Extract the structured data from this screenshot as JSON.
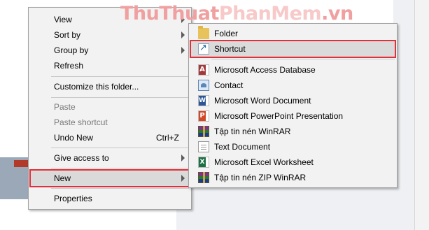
{
  "watermark": {
    "part1": "ThuThuat",
    "part2": "PhanMem",
    "part3": ".vn"
  },
  "context_menu": {
    "view": "View",
    "sort_by": "Sort by",
    "group_by": "Group by",
    "refresh": "Refresh",
    "customize": "Customize this folder...",
    "paste": "Paste",
    "paste_shortcut": "Paste shortcut",
    "undo_new": "Undo New",
    "undo_new_shortcut": "Ctrl+Z",
    "give_access": "Give access to",
    "new": "New",
    "properties": "Properties"
  },
  "submenu": {
    "folder": "Folder",
    "shortcut": "Shortcut",
    "access": "Microsoft Access Database",
    "contact": "Contact",
    "word": "Microsoft Word Document",
    "powerpoint": "Microsoft PowerPoint Presentation",
    "winrar": "Tập tin nén WinRAR",
    "text": "Text Document",
    "excel": "Microsoft Excel Worksheet",
    "zip": "Tập tin nén ZIP WinRAR"
  },
  "colors": {
    "highlight_outline": "#e0303a",
    "menu_background": "#f2f2f2",
    "menu_hover": "#dadada"
  },
  "icons": {
    "folder": "folder-icon",
    "shortcut": "shortcut-icon",
    "access": "access-icon",
    "contact": "contact-icon",
    "word": "word-icon",
    "powerpoint": "powerpoint-icon",
    "winrar": "winrar-icon",
    "text": "text-document-icon",
    "excel": "excel-icon",
    "zip": "zip-icon"
  }
}
